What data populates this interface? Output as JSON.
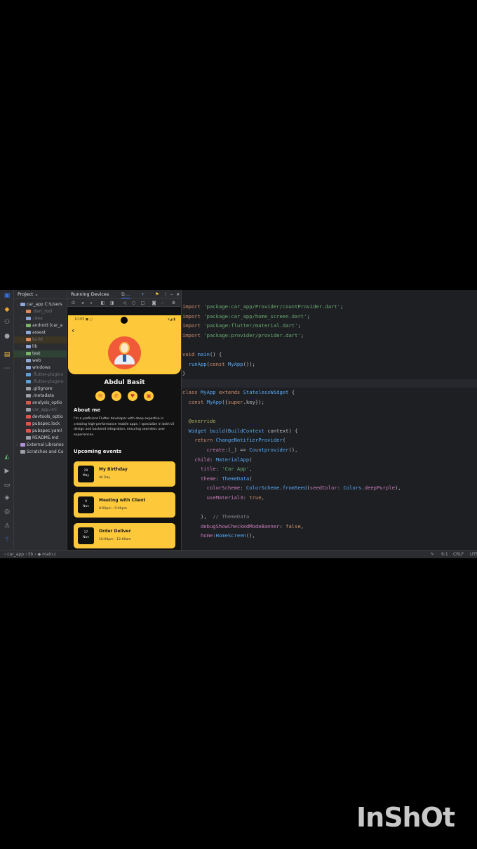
{
  "ide": {
    "project_panel": {
      "title": "Project ⌄",
      "items": [
        {
          "label": "car_app",
          "suffix": "C:\\Users",
          "indent": 0,
          "arrow": "⌄",
          "color": "#8fa8d8",
          "dim": false
        },
        {
          "label": ".dart_tool",
          "indent": 1,
          "arrow": "›",
          "color": "#e08a5b",
          "dim": true
        },
        {
          "label": ".idea",
          "indent": 1,
          "arrow": "›",
          "color": "#8fa8d8",
          "dim": true
        },
        {
          "label": "android",
          "suffix": "[car_a",
          "indent": 1,
          "arrow": "›",
          "color": "#7cb36b",
          "dim": false
        },
        {
          "label": "assest",
          "indent": 1,
          "arrow": "›",
          "color": "#8fa8d8",
          "dim": false
        },
        {
          "label": "build",
          "indent": 1,
          "arrow": "›",
          "color": "#e08a5b",
          "dim": true,
          "highlight": "sel2"
        },
        {
          "label": "lib",
          "indent": 1,
          "arrow": "›",
          "color": "#8fa8d8",
          "dim": false
        },
        {
          "label": "test",
          "indent": 1,
          "arrow": "›",
          "color": "#7cb36b",
          "dim": false,
          "highlight": "sel"
        },
        {
          "label": "web",
          "indent": 1,
          "arrow": "›",
          "color": "#8fa8d8",
          "dim": false
        },
        {
          "label": "windows",
          "indent": 1,
          "arrow": "›",
          "color": "#8fa8d8",
          "dim": false
        },
        {
          "label": ".flutter-plugins",
          "indent": 1,
          "arrow": "",
          "color": "#5f9fd8",
          "dim": true
        },
        {
          "label": ".flutter-plugins-",
          "indent": 1,
          "arrow": "",
          "color": "#5f9fd8",
          "dim": true
        },
        {
          "label": ".gitignore",
          "indent": 1,
          "arrow": "",
          "color": "#9da0a8",
          "dim": false
        },
        {
          "label": ".metadata",
          "indent": 1,
          "arrow": "",
          "color": "#9da0a8",
          "dim": false
        },
        {
          "label": "analysis_optio",
          "indent": 1,
          "arrow": "",
          "color": "#d8594b",
          "dim": false
        },
        {
          "label": "car_app.iml",
          "indent": 1,
          "arrow": "",
          "color": "#9da0a8",
          "dim": true
        },
        {
          "label": "devtools_optio",
          "indent": 1,
          "arrow": "",
          "color": "#d8594b",
          "dim": false
        },
        {
          "label": "pubspec.lock",
          "indent": 1,
          "arrow": "",
          "color": "#d8594b",
          "dim": false
        },
        {
          "label": "pubspec.yaml",
          "indent": 1,
          "arrow": "",
          "color": "#d8594b",
          "dim": false
        },
        {
          "label": "README.md",
          "indent": 1,
          "arrow": "",
          "color": "#9da0a8",
          "dim": false
        },
        {
          "label": "External Libraries",
          "indent": 0,
          "arrow": "›",
          "color": "#b08fd8",
          "dim": false
        },
        {
          "label": "Scratches and Co",
          "indent": 0,
          "arrow": "",
          "color": "#9da0a8",
          "dim": false
        }
      ]
    },
    "devices": {
      "tab_label": "Running Devices",
      "device_tab": "⧉ ...",
      "add": "+",
      "more": "⋮",
      "minimize": "–",
      "close": "×"
    },
    "editor_lines": [
      [
        [
          "kw",
          "import "
        ],
        [
          "str",
          "'package:car_app/Provider/countProvider.dart'"
        ],
        [
          "pun",
          ";"
        ]
      ],
      [
        [
          "kw",
          "import "
        ],
        [
          "str",
          "'package:car_app/home_screen.dart'"
        ],
        [
          "pun",
          ";"
        ]
      ],
      [
        [
          "kw",
          "import "
        ],
        [
          "str",
          "'package:flutter/material.dart'"
        ],
        [
          "pun",
          ";"
        ]
      ],
      [
        [
          "kw",
          "import "
        ],
        [
          "str",
          "'package:provider/provider.dart'"
        ],
        [
          "pun",
          ";"
        ]
      ],
      [],
      [
        [
          "kw",
          "void "
        ],
        [
          "cls",
          "main"
        ],
        [
          "pun",
          "() {"
        ]
      ],
      [
        [
          "pun",
          "  "
        ],
        [
          "cls",
          "runApp"
        ],
        [
          "pun",
          "("
        ],
        [
          "kw",
          "const "
        ],
        [
          "typ",
          "MyApp"
        ],
        [
          "pun",
          "());"
        ]
      ],
      [
        [
          "pun",
          "}"
        ]
      ],
      [],
      [
        [
          "kw",
          "class "
        ],
        [
          "typ",
          "MyApp "
        ],
        [
          "kw",
          "extends "
        ],
        [
          "typ",
          "StatelessWidget "
        ],
        [
          "pun",
          "{"
        ]
      ],
      [
        [
          "pun",
          "  "
        ],
        [
          "kw",
          "const "
        ],
        [
          "typ",
          "MyApp"
        ],
        [
          "pun",
          "({"
        ],
        [
          "kw",
          "super"
        ],
        [
          "pun",
          ".key});"
        ]
      ],
      [],
      [
        [
          "pun",
          "  "
        ],
        [
          "ann",
          "@override"
        ]
      ],
      [
        [
          "pun",
          "  "
        ],
        [
          "typ",
          "Widget "
        ],
        [
          "cls",
          "build"
        ],
        [
          "pun",
          "("
        ],
        [
          "typ",
          "BuildContext "
        ],
        [
          "pun",
          "context) {"
        ]
      ],
      [
        [
          "pun",
          "    "
        ],
        [
          "kw",
          "return "
        ],
        [
          "typ",
          "ChangeNotifierProvider"
        ],
        [
          "pun",
          "("
        ]
      ],
      [
        [
          "pun",
          "        "
        ],
        [
          "prop",
          "create"
        ],
        [
          "pun",
          ":(_) => "
        ],
        [
          "typ",
          "Countprovider"
        ],
        [
          "pun",
          "(),"
        ]
      ],
      [
        [
          "pun",
          "    "
        ],
        [
          "prop",
          "child"
        ],
        [
          "pun",
          ": "
        ],
        [
          "typ",
          "MaterialApp"
        ],
        [
          "pun",
          "("
        ]
      ],
      [
        [
          "pun",
          "      "
        ],
        [
          "prop",
          "title"
        ],
        [
          "pun",
          ": "
        ],
        [
          "str",
          "'Car App'"
        ],
        [
          "pun",
          ","
        ]
      ],
      [
        [
          "pun",
          "      "
        ],
        [
          "prop",
          "theme"
        ],
        [
          "pun",
          ": "
        ],
        [
          "typ",
          "ThemeData"
        ],
        [
          "pun",
          "("
        ]
      ],
      [
        [
          "pun",
          "        "
        ],
        [
          "prop",
          "colorScheme"
        ],
        [
          "pun",
          ": "
        ],
        [
          "typ",
          "ColorScheme"
        ],
        [
          "pun",
          "."
        ],
        [
          "cls",
          "fromSeed"
        ],
        [
          "pun",
          "("
        ],
        [
          "prop",
          "seedColor"
        ],
        [
          "pun",
          ": "
        ],
        [
          "typ",
          "Colors"
        ],
        [
          "pun",
          "."
        ],
        [
          "prop",
          "deepPurple"
        ],
        [
          "pun",
          "),"
        ]
      ],
      [
        [
          "pun",
          "        "
        ],
        [
          "prop",
          "useMaterial3"
        ],
        [
          "pun",
          ": "
        ],
        [
          "kw",
          "true"
        ],
        [
          "pun",
          ","
        ]
      ],
      [],
      [
        [
          "pun",
          "      ),  "
        ],
        [
          "cmt",
          "// ThemeData"
        ]
      ],
      [
        [
          "pun",
          "      "
        ],
        [
          "prop",
          "debugShowCheckedModeBanner"
        ],
        [
          "pun",
          ": "
        ],
        [
          "kw",
          "false"
        ],
        [
          "pun",
          ","
        ]
      ],
      [
        [
          "pun",
          "      "
        ],
        [
          "prop",
          "home"
        ],
        [
          "pun",
          ":"
        ],
        [
          "typ",
          "HomeScreen"
        ],
        [
          "pun",
          "(),"
        ]
      ]
    ],
    "statusbar": {
      "breadcrumb": "‹ car_app  ›  lib  ›  ◆ main.c",
      "position": "9:1",
      "line_sep": "CRLF",
      "encoding": "UTF"
    }
  },
  "phone": {
    "status_time": "10:05 ◼ ○",
    "status_icons": "▾◢ ▮",
    "back_icon": "‹",
    "profile_name": "Abdul Basit",
    "contact_icons": [
      "✉",
      "✆",
      "♥",
      "▣"
    ],
    "about_title": "About me",
    "about_text": "I'm a proficient Flutter developer with deep expertise in creating high-performance mobile apps. I specialize in both UI design and backend integration, ensuring seamless user experiences.",
    "events_title": "Upcoming events",
    "events": [
      {
        "day": "29",
        "month": "May",
        "title": "My Birthday",
        "time": "All Day"
      },
      {
        "day": "9",
        "month": "Nov",
        "title": "Meeting with Client",
        "time": "8:00pm - 9:00pm"
      },
      {
        "day": "17",
        "month": "Nov",
        "title": "Order Deliver",
        "time": "10:00pm - 12:00am"
      }
    ]
  },
  "watermark": "InShOt"
}
